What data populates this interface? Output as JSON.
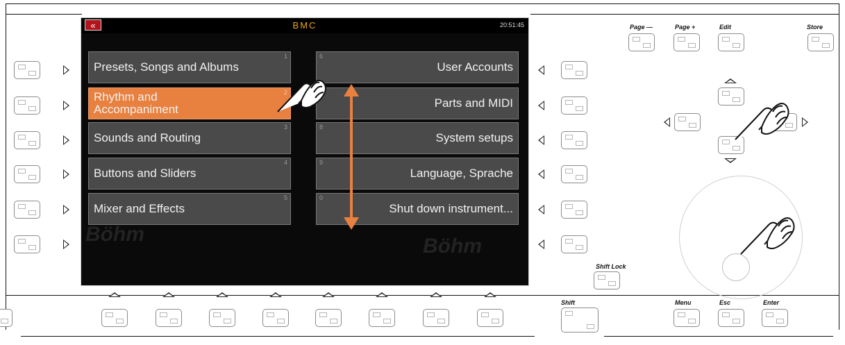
{
  "screen": {
    "back_symbol": "«",
    "title": "BMC",
    "time": "20:51:45",
    "watermark": "Böhm",
    "left_items": [
      {
        "label": "Presets, Songs and Albums",
        "num": "1"
      },
      {
        "label": "Rhythm and Accompaniment",
        "num": "2"
      },
      {
        "label": "Sounds and Routing",
        "num": "3"
      },
      {
        "label": "Buttons and Sliders",
        "num": "4"
      },
      {
        "label": "Mixer and Effects",
        "num": "5"
      }
    ],
    "right_items": [
      {
        "label": "User Accounts",
        "num": "6"
      },
      {
        "label": "Parts and MIDI",
        "num": "7"
      },
      {
        "label": "System setups",
        "num": "8"
      },
      {
        "label": "Language, Sprache",
        "num": "9"
      },
      {
        "label": "Shut down instrument...",
        "num": "0"
      }
    ]
  },
  "panel": {
    "page_minus": "Page —",
    "page_plus": "Page +",
    "edit": "Edit",
    "store": "Store",
    "shift_lock": "Shift Lock",
    "shift": "Shift",
    "menu": "Menu",
    "esc": "Esc",
    "enter": "Enter"
  },
  "colors": {
    "selected": "#e8803f",
    "arrow": "#e8803f",
    "title": "#e8a71a",
    "back_button": "#b1141b"
  }
}
